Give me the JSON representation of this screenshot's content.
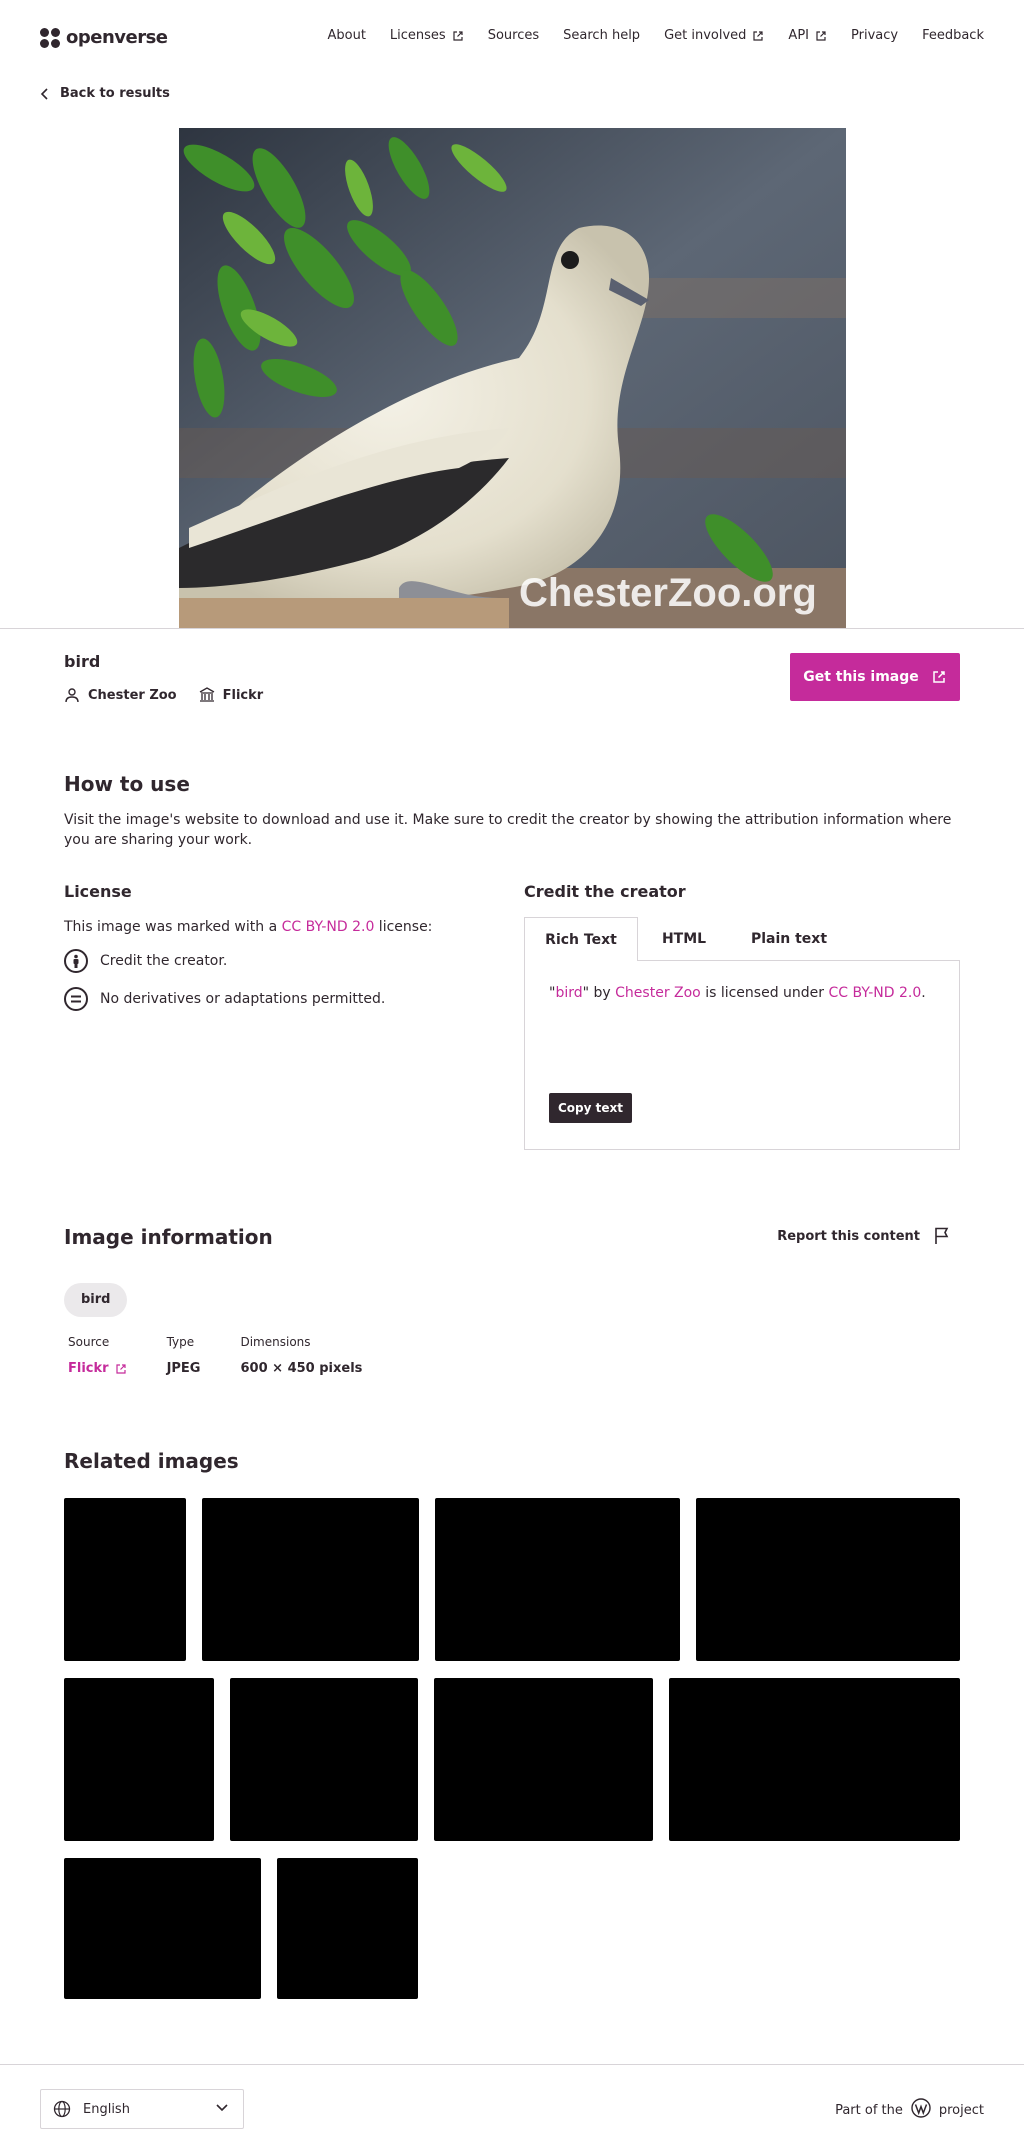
{
  "header": {
    "logo_text": "openverse",
    "nav": [
      {
        "label": "About",
        "external": false
      },
      {
        "label": "Licenses",
        "external": true
      },
      {
        "label": "Sources",
        "external": false
      },
      {
        "label": "Search help",
        "external": false
      },
      {
        "label": "Get involved",
        "external": true
      },
      {
        "label": "API",
        "external": true
      },
      {
        "label": "Privacy",
        "external": false
      },
      {
        "label": "Feedback",
        "external": false
      }
    ]
  },
  "back_label": "Back to results",
  "image": {
    "watermark": "ChesterZoo.org",
    "title": "bird",
    "creator": "Chester Zoo",
    "source": "Flickr",
    "get_button": "Get this image"
  },
  "how_to_use": {
    "heading": "How to use",
    "text": "Visit the image's website to download and use it. Make sure to credit the creator by showing the attribution information where you are sharing your work."
  },
  "license": {
    "heading": "License",
    "prefix": "This image was marked with a ",
    "name": "CC BY-ND 2.0",
    "suffix": " license:",
    "items": [
      {
        "icon": "by-icon",
        "text": "Credit the creator."
      },
      {
        "icon": "nd-icon",
        "text": "No derivatives or adaptations permitted."
      }
    ]
  },
  "credit": {
    "heading": "Credit the creator",
    "tabs": [
      "Rich Text",
      "HTML",
      "Plain text"
    ],
    "q1": "\"",
    "title": "bird",
    "q2": "\" by ",
    "creator": "Chester Zoo",
    "mid": " is licensed under ",
    "license": "CC BY-ND 2.0",
    "end": ".",
    "copy_button": "Copy text"
  },
  "info": {
    "heading": "Image information",
    "report": "Report this content",
    "tag": "bird",
    "source_label": "Source",
    "source_value": "Flickr",
    "type_label": "Type",
    "type_value": "JPEG",
    "dims_label": "Dimensions",
    "dims_value": "600 × 450 pixels"
  },
  "related_heading": "Related images",
  "footer": {
    "language": "English",
    "part_prefix": "Part of the",
    "part_suffix": "project"
  },
  "colors": {
    "accent": "#c52b9b",
    "text": "#30272e"
  }
}
